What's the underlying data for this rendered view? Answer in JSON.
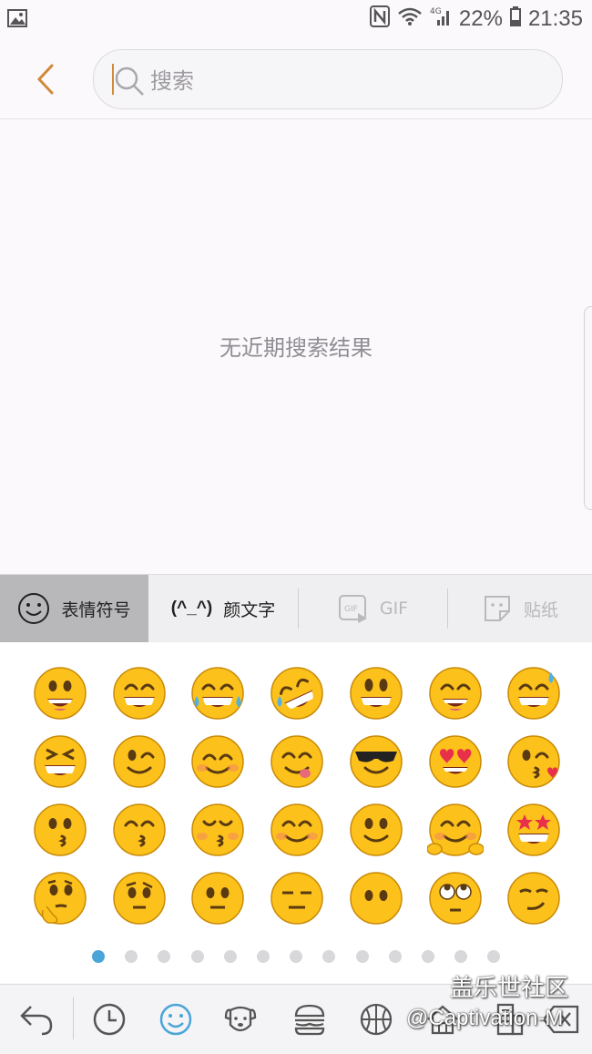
{
  "status_bar": {
    "battery": "22%",
    "time": "21:35",
    "network": "4G"
  },
  "search": {
    "placeholder": "搜索"
  },
  "empty": {
    "message": "无近期搜索结果"
  },
  "tabs": [
    {
      "label": "表情符号",
      "icon": "smiley-outline-icon",
      "active": true
    },
    {
      "prefix": "(^_^)",
      "label": "颜文字"
    },
    {
      "label": "GIF",
      "icon": "gif-icon",
      "disabled": true
    },
    {
      "label": "贴纸",
      "icon": "sticker-icon",
      "disabled": true
    }
  ],
  "emoji_grid": [
    [
      "grinning",
      "beaming",
      "tears-of-joy",
      "rolling-laughing",
      "grinning-big-eyes",
      "grinning-smiling-eyes",
      "sweat-smile"
    ],
    [
      "squinting-laugh",
      "winking",
      "smiling-blush",
      "savoring-food",
      "sunglasses",
      "heart-eyes",
      "blowing-kiss"
    ],
    [
      "kissing",
      "kissing-smiling-eyes",
      "kissing-closed-eyes",
      "smiling-relaxed",
      "slightly-smiling",
      "hugging",
      "star-struck"
    ],
    [
      "thinking",
      "raised-eyebrow",
      "neutral",
      "expressionless",
      "no-mouth",
      "rolling-eyes",
      "smirking"
    ]
  ],
  "page_indicator": {
    "total": 13,
    "current": 1
  },
  "categories": [
    "undo-arrow-icon",
    "recent-clock-icon",
    "smiley-icon",
    "animal-dog-icon",
    "food-burger-icon",
    "sports-ball-icon",
    "travel-house-icon",
    "objects-building-icon",
    "backspace-icon"
  ],
  "watermark": {
    "line1": "盖乐世社区",
    "line2": "@Captivation-M"
  },
  "colors": {
    "accent": "#d08a3a",
    "active_dot": "#4aa5d8",
    "emoji_face": "#fcc21b"
  }
}
